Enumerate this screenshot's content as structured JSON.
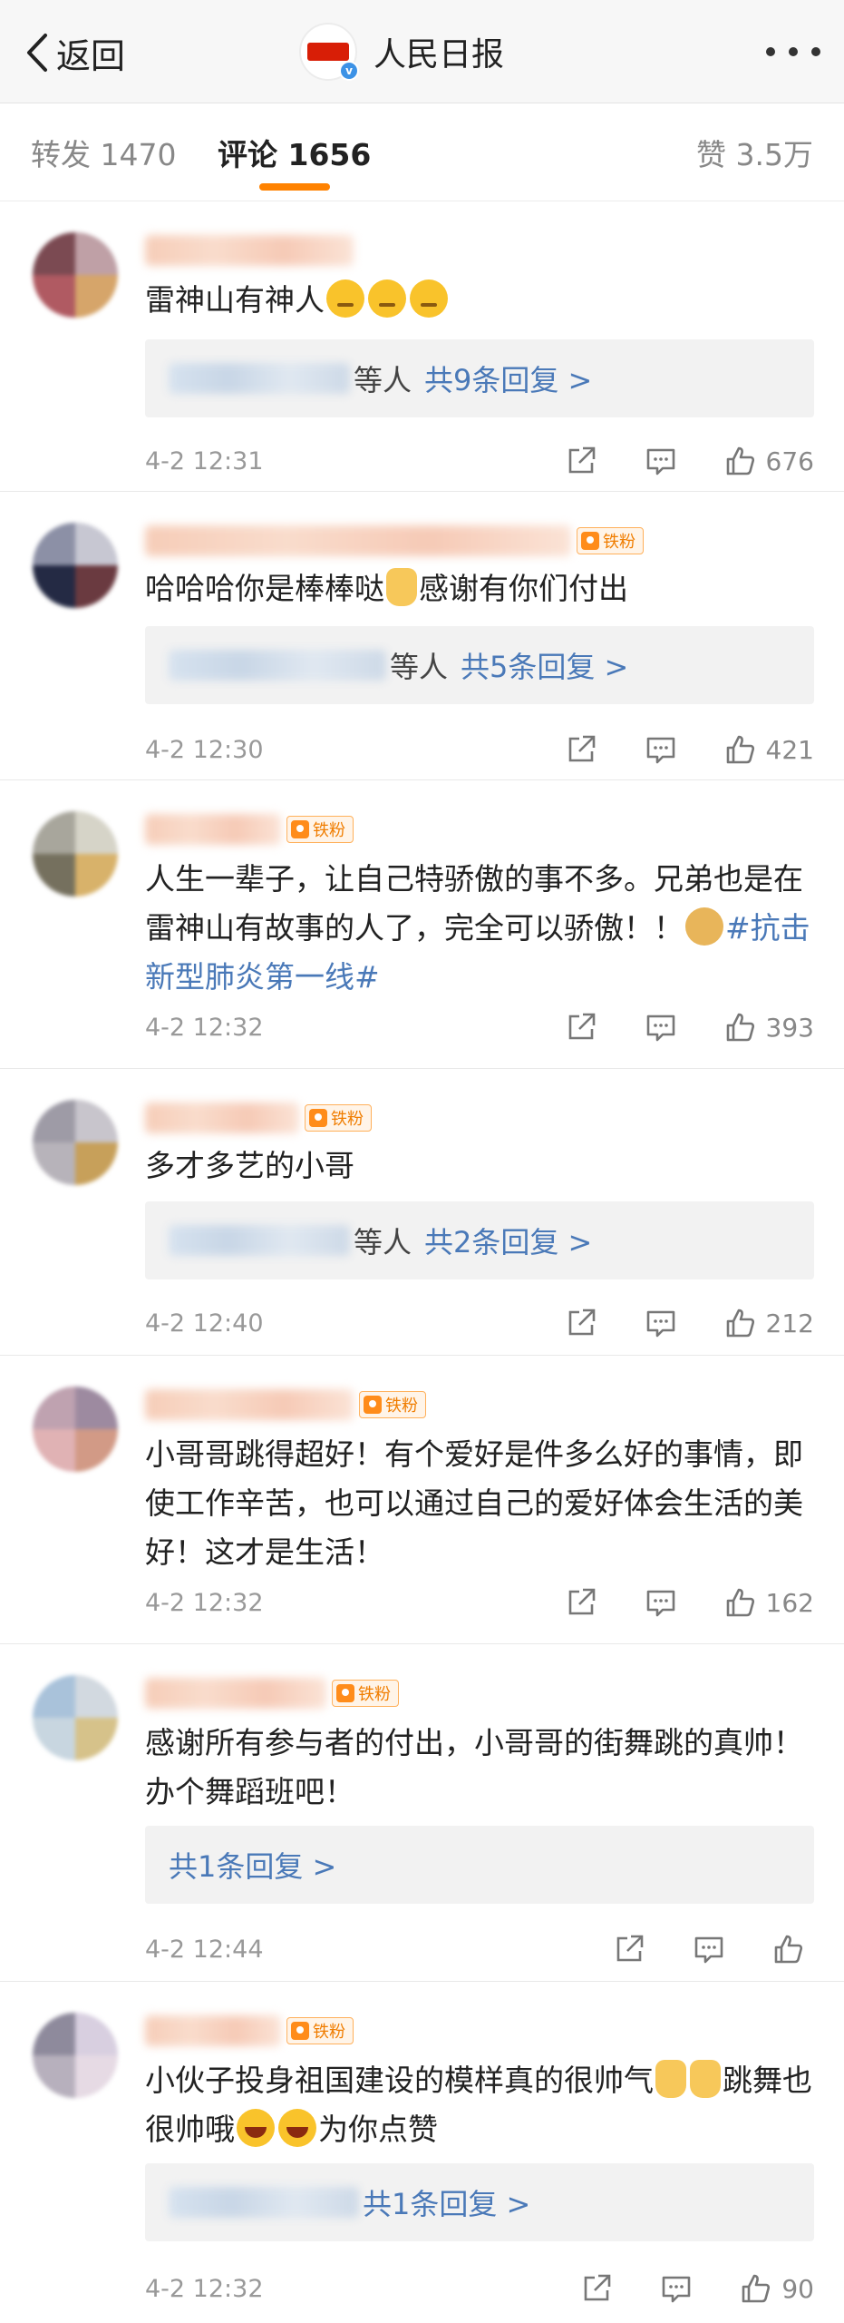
{
  "header": {
    "back_label": "返回",
    "title": "人民日报",
    "logo_icon": "people-daily-logo",
    "verified_icon": "verified-v-icon",
    "more_icon": "more-dots-icon"
  },
  "tabs": {
    "repost": "转发 1470",
    "comment": "评论 1656",
    "like": "赞 3.5万",
    "accent_color": "#ff8200"
  },
  "fan_badge_label": "铁粉",
  "link_color": "#4a79b8",
  "comments": [
    {
      "text": "雷神山有神人",
      "replies": {
        "suffix": "等人",
        "count": "共9条回复 >"
      },
      "time": "4-2 12:31",
      "likes": "676"
    },
    {
      "text_a": "哈哈哈你是棒棒哒",
      "text_b": "感谢有你们付出",
      "replies": {
        "suffix": "等人",
        "count": "共5条回复 >"
      },
      "time": "4-2 12:30",
      "likes": "421"
    },
    {
      "text": "人生一辈子，让自己特骄傲的事不多。兄弟也是在雷神山有故事的人了，完全可以骄傲！！",
      "hashtag": "#抗击新型肺炎第一线#",
      "time": "4-2 12:32",
      "likes": "393"
    },
    {
      "text": "多才多艺的小哥",
      "replies": {
        "suffix": "等人",
        "count": "共2条回复 >"
      },
      "time": "4-2 12:40",
      "likes": "212"
    },
    {
      "text": "小哥哥跳得超好！有个爱好是件多么好的事情，即使工作辛苦，也可以通过自己的爱好体会生活的美好！这才是生活！",
      "time": "4-2 12:32",
      "likes": "162"
    },
    {
      "text": "感谢所有参与者的付出，小哥哥的街舞跳的真帅！办个舞蹈班吧！",
      "replies": {
        "count": "共1条回复 >"
      },
      "time": "4-2 12:44",
      "likes": ""
    },
    {
      "text_a": "小伙子投身祖国建设的模样真的很帅气",
      "text_b": "跳舞也很帅哦",
      "text_c": "为你点赞",
      "replies": {
        "count": "共1条回复 >"
      },
      "time": "4-2 12:32",
      "likes": "90"
    }
  ]
}
